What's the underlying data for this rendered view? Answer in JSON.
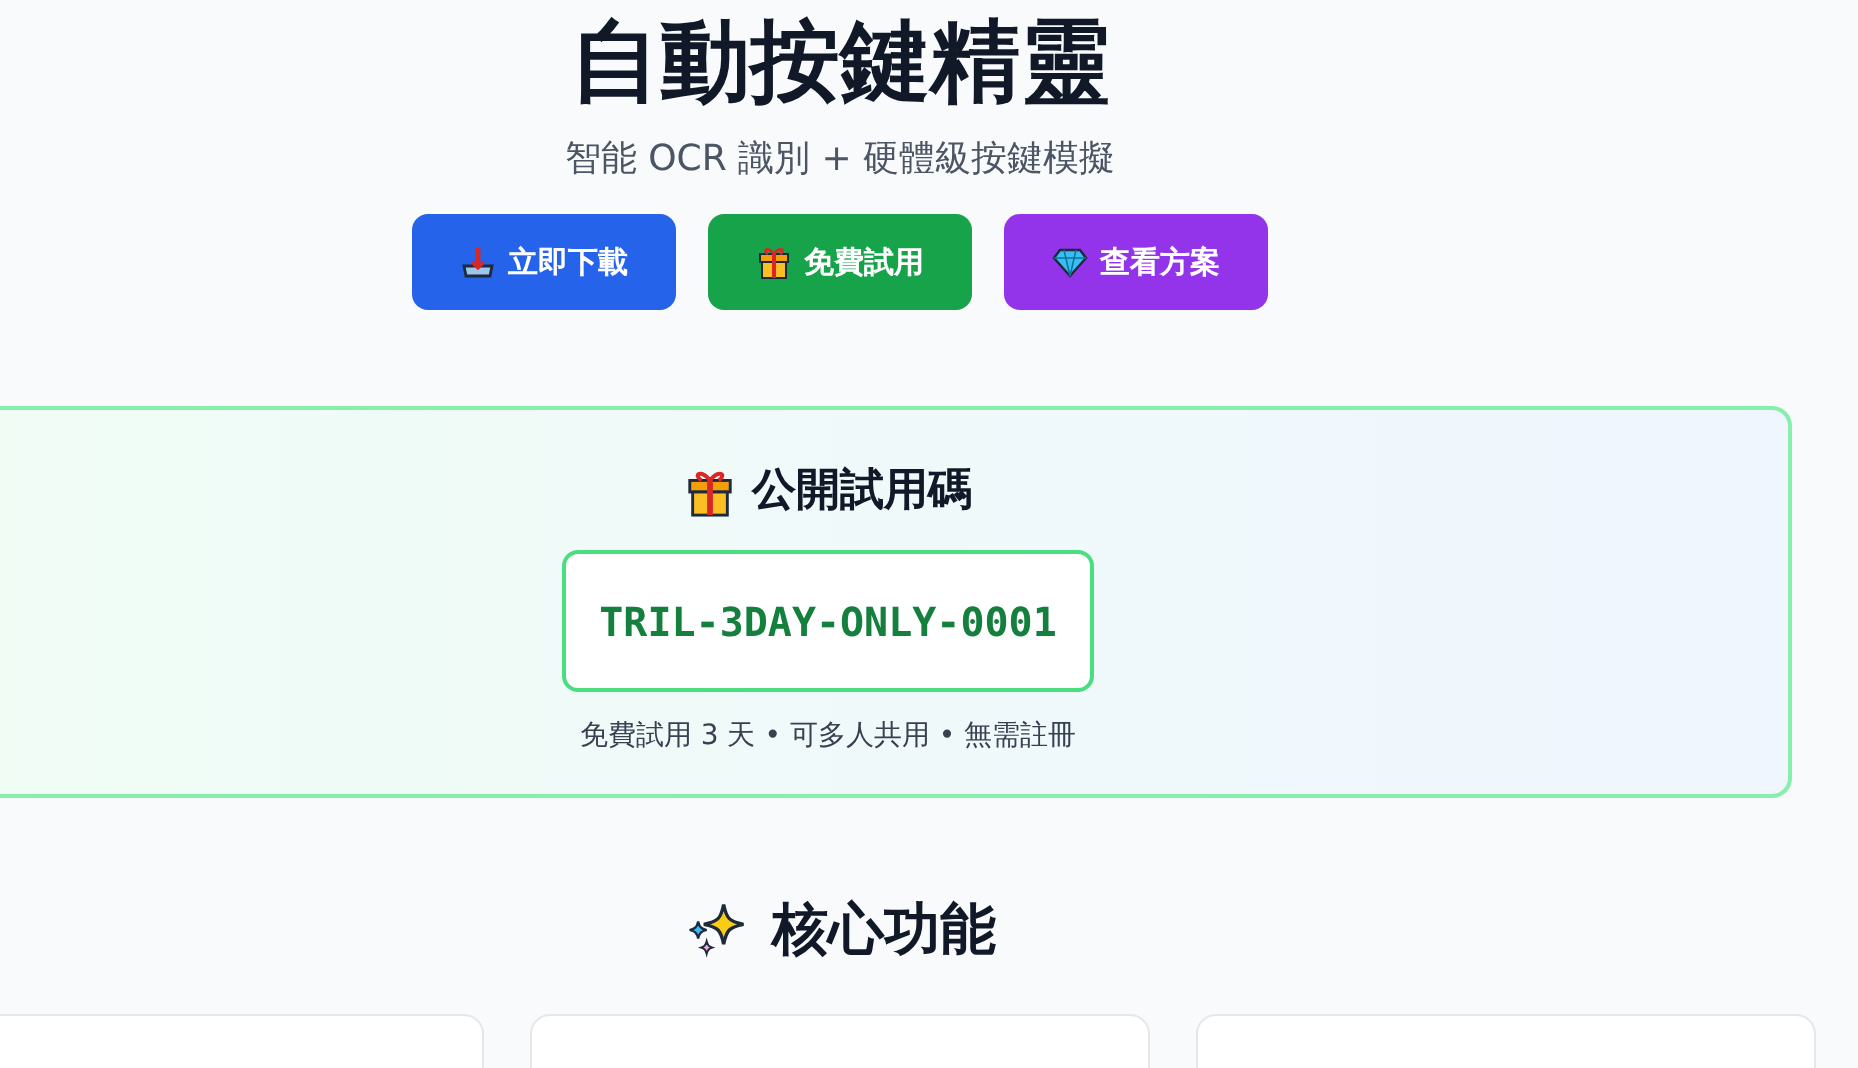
{
  "hero": {
    "title": "自動按鍵精靈",
    "subtitle": "智能 OCR 識別 + 硬體級按鍵模擬"
  },
  "buttons": [
    {
      "label": "立即下載",
      "kind": "download",
      "color": "#2563eb"
    },
    {
      "label": "免費試用",
      "kind": "gift",
      "color": "#16a34a"
    },
    {
      "label": "查看方案",
      "kind": "diamond",
      "color": "#9333ea"
    }
  ],
  "trial": {
    "heading": "公開試用碼",
    "code": "TRIL-3DAY-ONLY-0001",
    "note": "免費試用 3 天 • 可多人共用 • 無需註冊"
  },
  "features": {
    "heading": "核心功能",
    "cards": [
      {
        "kind": "card"
      },
      {
        "kind": "card"
      },
      {
        "kind": "card"
      }
    ]
  }
}
